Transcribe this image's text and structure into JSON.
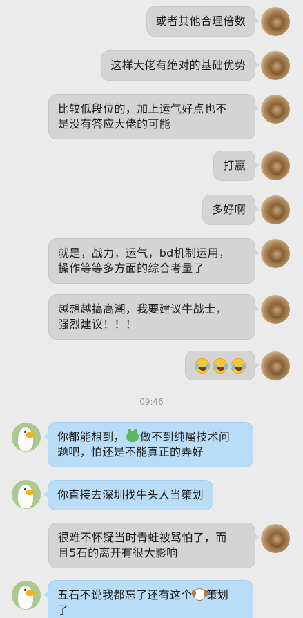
{
  "messages": [
    {
      "side": "out",
      "text": "或者其他合理倍数"
    },
    {
      "side": "out",
      "text": "这样大佬有绝对的基础优势"
    },
    {
      "side": "out",
      "line1": "比较低段位的，加上运气好点也不",
      "line2": "是没有答应大佬的可能"
    },
    {
      "side": "out",
      "text": "打赢"
    },
    {
      "side": "out",
      "text": "多好啊"
    },
    {
      "side": "out",
      "line1": "就是，战力，运气，bd机制运用，",
      "line2": "操作等等多方面的综合考量了"
    },
    {
      "side": "out",
      "line1": "越想越搞高潮，我要建议牛战士，",
      "line2": "强烈建议！！！"
    },
    {
      "side": "out",
      "emoji": "laughing-tears-emoji x3"
    },
    {
      "side": "in",
      "line1a": "你都能想到，",
      "line1b": "做不到纯属技术问",
      "line2": "题吧，怕还是不能真正的弄好"
    },
    {
      "side": "in",
      "text": "你直接去深圳找牛头人当策划"
    },
    {
      "side": "out",
      "line1": "很难不怀疑当时青蛙被骂怕了，而",
      "line2": "且5石的离开有很大影响"
    },
    {
      "side": "in",
      "line1a": "五石不说我都忘了还有这个",
      "line1b": "策划",
      "line2": "了"
    }
  ],
  "timestamp": "09:46",
  "colors": {
    "background": "#ebebeb",
    "outgoing_bubble": "#d4d4d4",
    "incoming_bubble": "#b9dcf7"
  }
}
